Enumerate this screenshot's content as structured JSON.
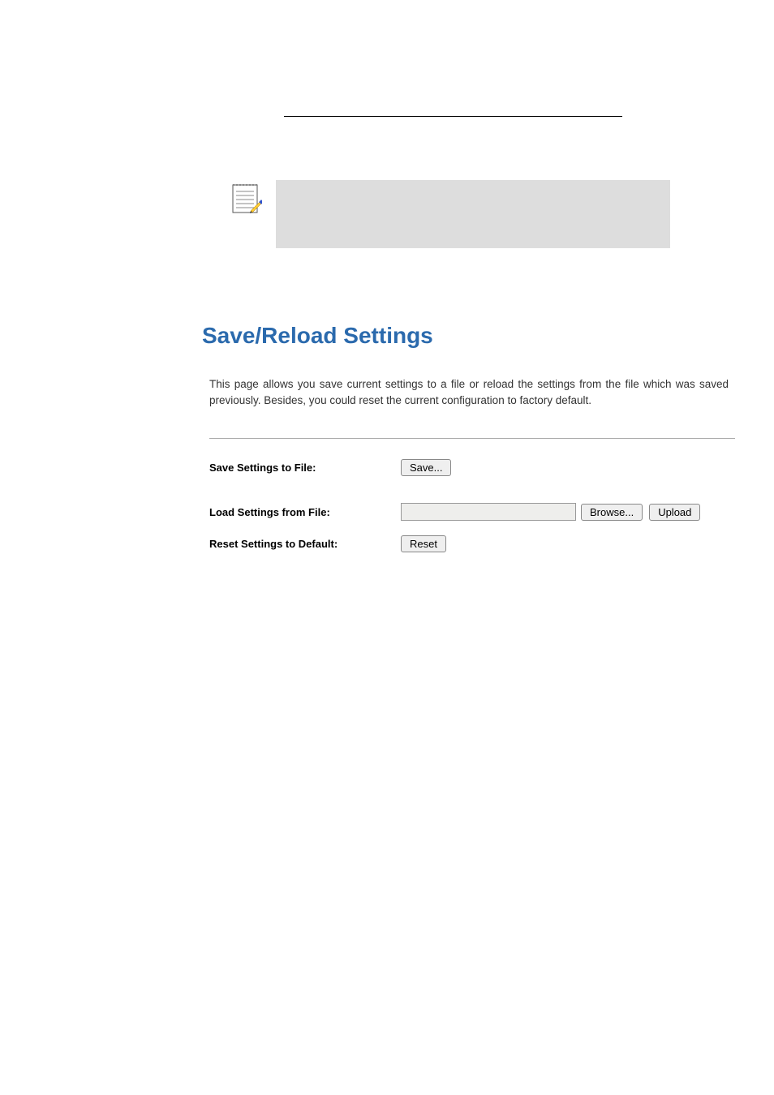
{
  "page": {
    "title": "Save/Reload Settings",
    "description": "This page allows you save current settings to a file or reload the settings from the file which was saved previously. Besides, you could reset the current configuration to factory default."
  },
  "form": {
    "save": {
      "label": "Save Settings to File:",
      "button": "Save..."
    },
    "load": {
      "label": "Load Settings from File:",
      "file_value": "",
      "browse_button": "Browse...",
      "upload_button": "Upload"
    },
    "reset": {
      "label": "Reset Settings to Default:",
      "button": "Reset"
    }
  },
  "icons": {
    "note": "note-icon"
  }
}
